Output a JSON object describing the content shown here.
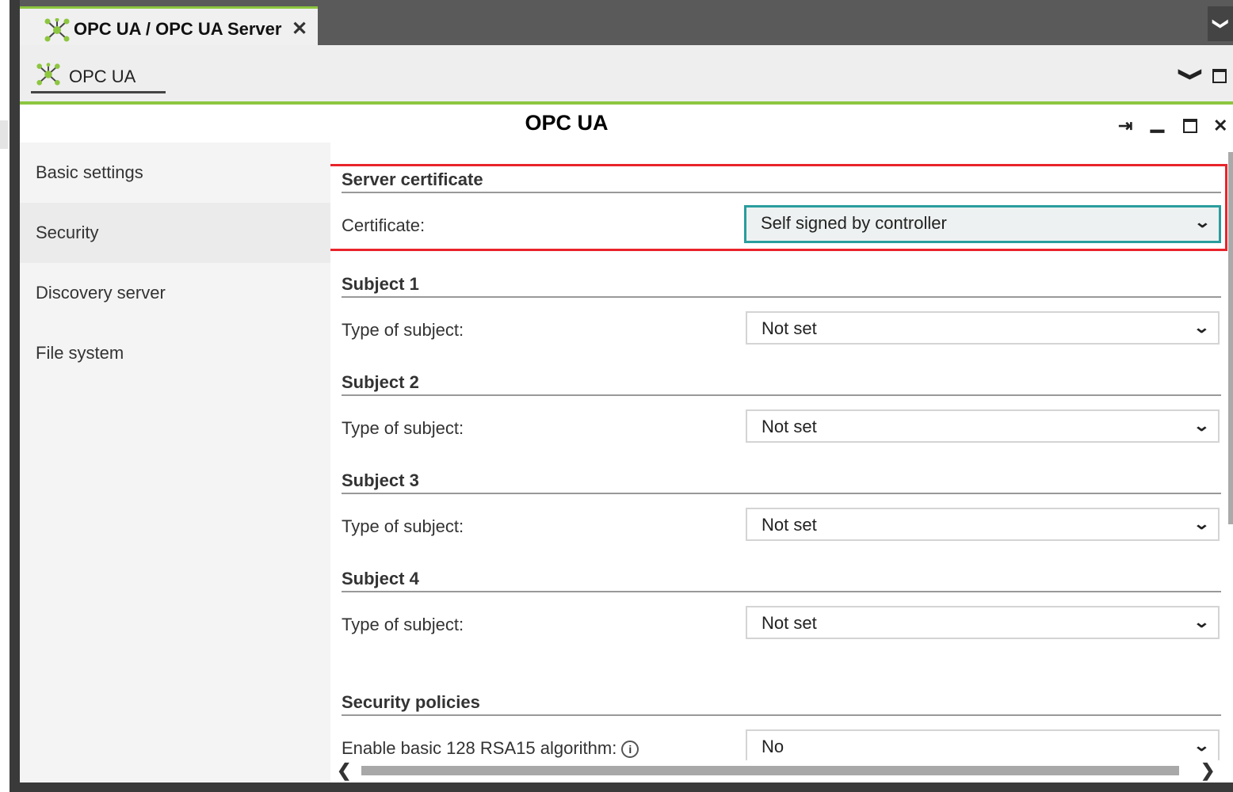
{
  "tab": {
    "title": "OPC UA / OPC UA Server",
    "close": "✕"
  },
  "tabbar": {
    "overflow": "❯"
  },
  "breadcrumb": {
    "label": "OPC UA"
  },
  "panel": {
    "title": "OPC UA",
    "pin": "⇥",
    "minimize": "▁",
    "close": "✕"
  },
  "sidebar": {
    "items": [
      {
        "label": "Basic settings"
      },
      {
        "label": "Security"
      },
      {
        "label": "Discovery server"
      },
      {
        "label": "File system"
      }
    ]
  },
  "content": {
    "server_certificate": {
      "heading": "Server certificate",
      "label": "Certificate:",
      "value": "Self signed by controller"
    },
    "subjects": [
      {
        "heading": "Subject 1",
        "label": "Type of subject:",
        "value": "Not set"
      },
      {
        "heading": "Subject 2",
        "label": "Type of subject:",
        "value": "Not set"
      },
      {
        "heading": "Subject 3",
        "label": "Type of subject:",
        "value": "Not set"
      },
      {
        "heading": "Subject 4",
        "label": "Type of subject:",
        "value": "Not set"
      }
    ],
    "security_policies": {
      "heading": "Security policies",
      "label": "Enable basic 128 RSA15 algorithm:",
      "info": "i",
      "value": "No"
    }
  },
  "scroll": {
    "left": "❮",
    "right": "❯"
  },
  "colors": {
    "accent": "#8dc63f",
    "focus": "#2a9d9d",
    "highlight": "#e8242a"
  }
}
